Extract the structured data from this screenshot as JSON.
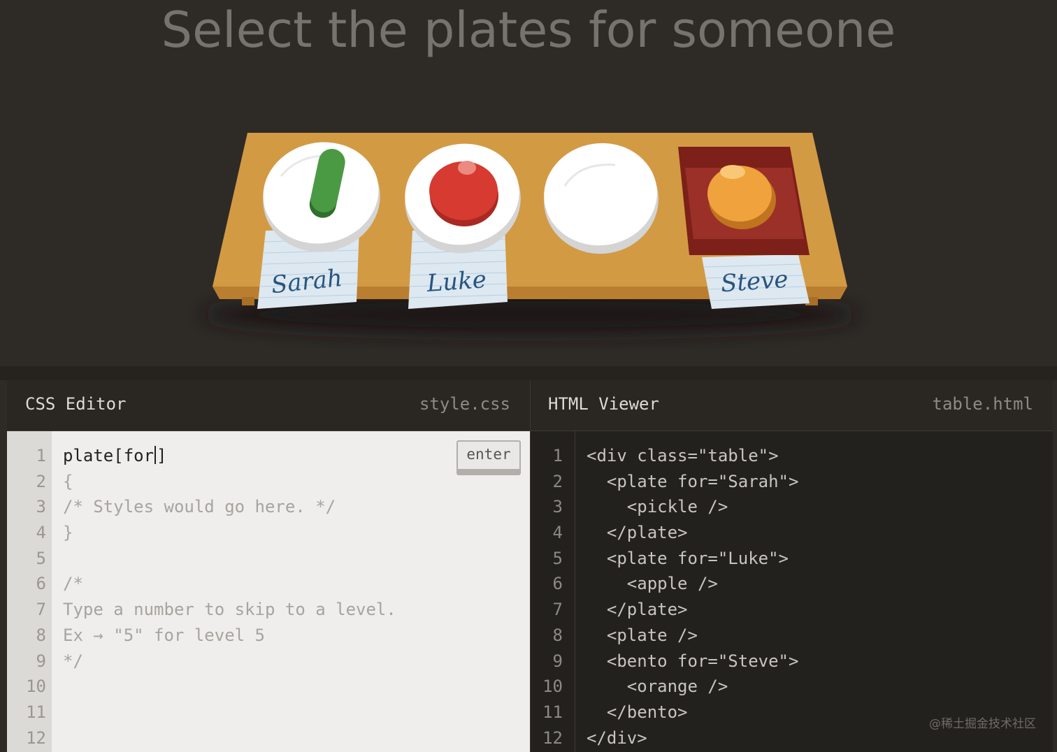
{
  "level": {
    "instruction": "Select the plates for someone"
  },
  "table_scene": {
    "name_tags": [
      "Sarah",
      "Luke",
      "Steve"
    ],
    "colors": {
      "table": "#d39a44",
      "plate": "#ffffff",
      "pickle": "#4a9a44",
      "apple": "#d63a30",
      "orange": "#f0a23c",
      "bento": "#8e2a24",
      "name_tag": "#dde8f0",
      "name_text": "#27557f"
    }
  },
  "css_editor": {
    "title": "CSS Editor",
    "filename": "style.css",
    "input_value": "plate[for]",
    "input_before_caret": "plate[for",
    "input_after_caret": "]",
    "enter_label": "enter",
    "line_numbers": [
      "1",
      "2",
      "3",
      "4",
      "5",
      "6",
      "7",
      "8",
      "9",
      "10",
      "11",
      "12"
    ],
    "lines": [
      "{",
      "/* Styles would go here. */",
      "}",
      "",
      "/*",
      "Type a number to skip to a level.",
      "Ex → \"5\" for level 5",
      "*/",
      "",
      "",
      ""
    ]
  },
  "html_viewer": {
    "title": "HTML Viewer",
    "filename": "table.html",
    "line_numbers": [
      "1",
      "2",
      "3",
      "4",
      "5",
      "6",
      "7",
      "8",
      "9",
      "10",
      "11",
      "12"
    ],
    "lines": [
      "<div class=\"table\">",
      "  <plate for=\"Sarah\">",
      "    <pickle />",
      "  </plate>",
      "  <plate for=\"Luke\">",
      "    <apple />",
      "  </plate>",
      "  <plate />",
      "  <bento for=\"Steve\">",
      "    <orange />",
      "  </bento>",
      "</div>"
    ]
  },
  "watermark": "@稀土掘金技术社区"
}
